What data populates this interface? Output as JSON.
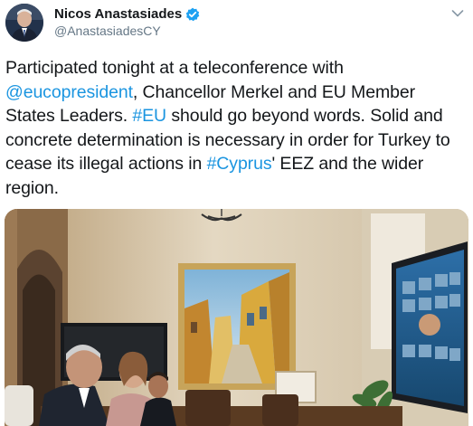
{
  "author": {
    "name": "Nicos Anastasiades",
    "handle": "@AnastasiadesCY",
    "verified": true
  },
  "menu": {
    "icon": "chevron-down-icon"
  },
  "tweet": {
    "t1": "Participated tonight at a teleconference with ",
    "mention": "@eucopresident",
    "t2": ", Chancellor Merkel and EU Member States Leaders. ",
    "tag_eu": "#EU",
    "t3": " should go beyond words. Solid and concrete determination is necessary in order for Turkey to cease its illegal actions in ",
    "tag_cyprus": "#Cyprus",
    "t4": "' EEZ and the wider region."
  },
  "colors": {
    "link": "#1b95e0",
    "text": "#14171a",
    "secondary": "#657786",
    "verified": "#1da1f2"
  }
}
